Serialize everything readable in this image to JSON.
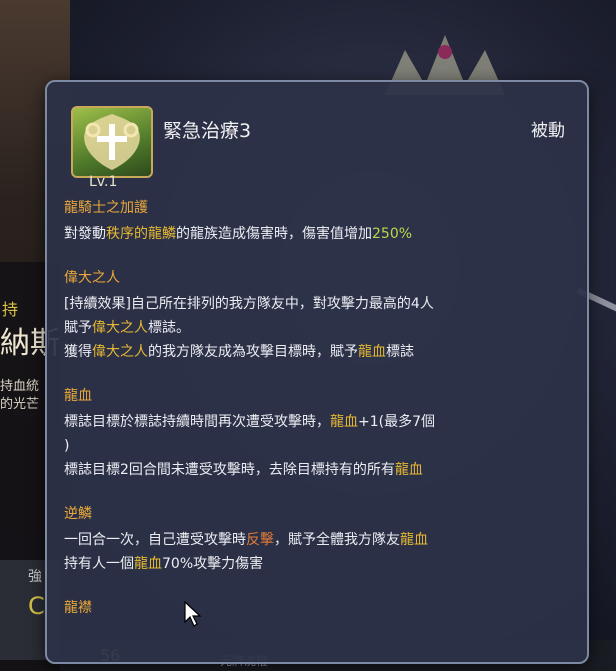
{
  "background": {
    "left_tag": "持",
    "left_name": "納斯",
    "left_desc_1": "持血統",
    "left_desc_2": "的光芒",
    "left_box_label": "強",
    "left_box_value": "C",
    "bottom_number": "56",
    "bottom_text": "元牌沈權"
  },
  "skill": {
    "icon": "dragon-crest-icon",
    "level": "Lv.1",
    "name": "緊急治療3",
    "type": "被動"
  },
  "sections": {
    "s1": {
      "title": "龍騎士之加護",
      "l1_a": "對發動",
      "l1_b": "秩序的龍鱗",
      "l1_c": "的龍族造成傷害時，傷害值增加",
      "l1_d": "250%"
    },
    "s2": {
      "title": "偉大之人",
      "l1": "[持續效果]自己所在排列的我方隊友中，對攻擊力最高的4人",
      "l2_a": "賦予",
      "l2_b": "偉大之人",
      "l2_c": "標誌。",
      "l3_a": "獲得",
      "l3_b": "偉大之人",
      "l3_c": "的我方隊友成為攻擊目標時，賦予",
      "l3_d": "龍血",
      "l3_e": "標誌"
    },
    "s3": {
      "title": "龍血",
      "l1_a": "標誌目標於標誌持續時間再次遭受攻擊時，",
      "l1_b": "龍血",
      "l1_c": "+1(最多7個",
      "l2": ")",
      "l3_a": "標誌目標2回合間未遭受攻擊時，去除目標持有的所有",
      "l3_b": "龍血"
    },
    "s4": {
      "title": "逆鱗",
      "l1_a": "一回合一次，自己遭受攻擊時",
      "l1_b": "反擊",
      "l1_c": "，賦予全體我方隊友",
      "l1_d": "龍血",
      "l2_a": "持有人一個",
      "l2_b": "龍血",
      "l2_c": "70%攻擊力傷害"
    },
    "s5": {
      "title": "龍襟"
    }
  },
  "colors": {
    "section_title": "#e8a83a",
    "highlight_yellow": "#e6b832",
    "highlight_orange": "#e07b3a",
    "highlight_green": "#b7d94a"
  }
}
